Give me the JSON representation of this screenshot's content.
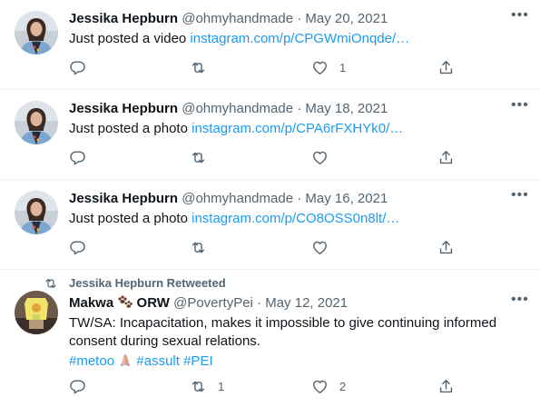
{
  "tweets": [
    {
      "name": "Jessika Hepburn",
      "handle": "@ohmyhandmade",
      "separator": "·",
      "date": "May 20, 2021",
      "text_prefix": "Just posted a video ",
      "link": "instagram.com/p/CPGWmiOnqde/…",
      "reply_count": "",
      "retweet_count": "",
      "like_count": "1"
    },
    {
      "name": "Jessika Hepburn",
      "handle": "@ohmyhandmade",
      "separator": "·",
      "date": "May 18, 2021",
      "text_prefix": "Just posted a photo ",
      "link": "instagram.com/p/CPA6rFXHYk0/…",
      "reply_count": "",
      "retweet_count": "",
      "like_count": ""
    },
    {
      "name": "Jessika Hepburn",
      "handle": "@ohmyhandmade",
      "separator": "·",
      "date": "May 16, 2021",
      "text_prefix": "Just posted a photo ",
      "link": "instagram.com/p/CO8OSS0n8lt/…",
      "reply_count": "",
      "retweet_count": "",
      "like_count": ""
    },
    {
      "retweeted_by": "Jessika Hepburn Retweeted",
      "name": "Makwa",
      "name_suffix": "ORW",
      "handle": "@PovertyPei",
      "separator": "·",
      "date": "May 12, 2021",
      "text": "TW/SA: Incapacitation, makes it impossible to give continuing informed consent during sexual relations.",
      "hashtags": [
        "#metoo",
        "#assult",
        "#PEI"
      ],
      "reply_count": "",
      "retweet_count": "1",
      "like_count": "2"
    }
  ],
  "icons": {
    "reply": "reply-icon",
    "retweet": "retweet-icon",
    "like": "like-icon",
    "share": "share-icon",
    "more": "more-icon",
    "paw": "paw-prints-icon",
    "hands": "folded-hands-icon"
  },
  "colors": {
    "link": "#1d9bf0",
    "secondary": "#536471",
    "text": "#0f1419",
    "divider": "#eff3f4"
  }
}
